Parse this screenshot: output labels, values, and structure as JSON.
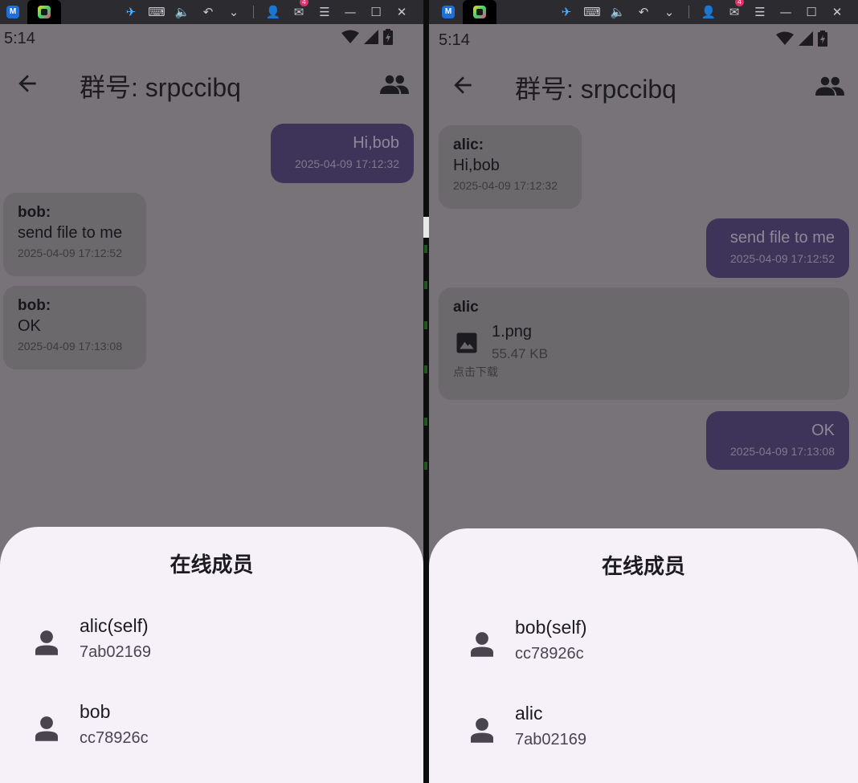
{
  "left": {
    "status_time": "5:14",
    "title": "群号: srpccibq",
    "messages": [
      {
        "sender": "",
        "text": "Hi,bob",
        "time": "2025-04-09 17:12:32"
      },
      {
        "sender": "bob:",
        "text": "send file to me",
        "time": "2025-04-09 17:12:52"
      },
      {
        "sender": "bob:",
        "text": "OK",
        "time": "2025-04-09 17:13:08"
      }
    ],
    "sheet": {
      "title": "在线成员",
      "members": [
        {
          "name": "alic(self)",
          "id": "7ab02169"
        },
        {
          "name": "bob",
          "id": "cc78926c"
        }
      ]
    }
  },
  "right": {
    "status_time": "5:14",
    "title": "群号: srpccibq",
    "messages": [
      {
        "sender": "alic:",
        "text": "Hi,bob",
        "time": "2025-04-09 17:12:32"
      },
      {
        "sender": "",
        "text": "send file to me",
        "time": "2025-04-09 17:12:52"
      },
      {
        "sender": "",
        "text": "OK",
        "time": "2025-04-09 17:13:08"
      }
    ],
    "file_message": {
      "sender": "alic",
      "file_name": "1.png",
      "file_size": "55.47 KB",
      "hint": "点击下载"
    },
    "sheet": {
      "title": "在线成员",
      "members": [
        {
          "name": "bob(self)",
          "id": "cc78926c"
        },
        {
          "name": "alic",
          "id": "7ab02169"
        }
      ]
    }
  },
  "taskbar": {
    "mail_badge": "4",
    "icons": [
      "app-logo-icon",
      "chat-app-tab-icon",
      "pin-icon",
      "keyboard-icon",
      "volume-icon",
      "undo-icon",
      "chevron-down-icon",
      "user-icon",
      "mail-icon",
      "menu-icon",
      "minimize-icon",
      "maximize-icon",
      "close-icon"
    ]
  },
  "colors": {
    "scrim_bg": "#787379",
    "outgoing_bubble": "#3e3459",
    "incoming_bubble": "#6b696c",
    "sheet_bg": "#f6f1f8",
    "window_bar": "#2b2b30"
  }
}
